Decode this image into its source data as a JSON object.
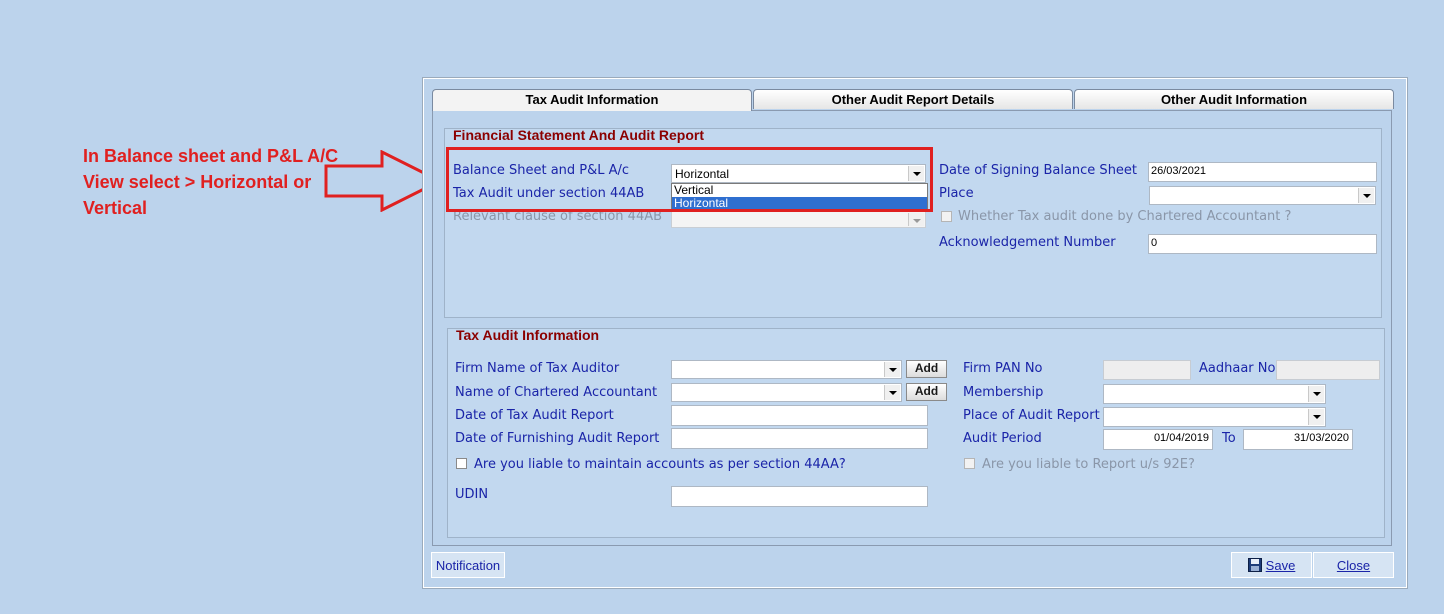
{
  "annotation": {
    "lines": [
      "In Balance sheet and P&L A/C",
      "View select > Horizontal or",
      "Vertical"
    ],
    "color": "#e02020"
  },
  "tabs": [
    {
      "label": "Tax Audit Information",
      "active": true
    },
    {
      "label": "Other Audit Report Details",
      "active": false
    },
    {
      "label": "Other Audit Information",
      "active": false
    }
  ],
  "financial": {
    "title": "Financial Statement And Audit Report",
    "balance_sheet_label": "Balance Sheet and P&L A/c",
    "balance_sheet_value": "Horizontal",
    "balance_sheet_options": [
      "Vertical",
      "Horizontal"
    ],
    "tax_audit_label": "Tax Audit  under section 44AB",
    "relevant_clause_label": "Relevant clause of section 44AB",
    "date_signing_label": "Date of Signing Balance Sheet",
    "date_signing_value": "26/03/2021",
    "place_label": "Place",
    "chartered_check_label": "Whether Tax audit done by Chartered Accountant ?",
    "ack_label": "Acknowledgement Number",
    "ack_value": "0"
  },
  "tax_audit": {
    "title": "Tax Audit Information",
    "firm_name_label": "Firm Name of Tax Auditor",
    "ca_name_label": "Name of Chartered Accountant",
    "date_report_label": "Date of Tax Audit Report",
    "date_furnishing_label": "Date of Furnishing Audit Report",
    "add_label": "Add",
    "firm_pan_label": "Firm PAN No",
    "aadhaar_label": "Aadhaar No",
    "membership_label": "Membership",
    "place_report_label": "Place of Audit Report",
    "audit_period_label": "Audit Period",
    "audit_from": "01/04/2019",
    "to_label": "To",
    "audit_to": "31/03/2020",
    "liable_44aa_label": "Are you liable to maintain accounts as per section 44AA?",
    "liable_92e_label": "Are you liable to Report u/s 92E?",
    "udin_label": "UDIN"
  },
  "footer": {
    "notification_label": "Notification",
    "save_label": "Save",
    "close_label": "Close"
  }
}
